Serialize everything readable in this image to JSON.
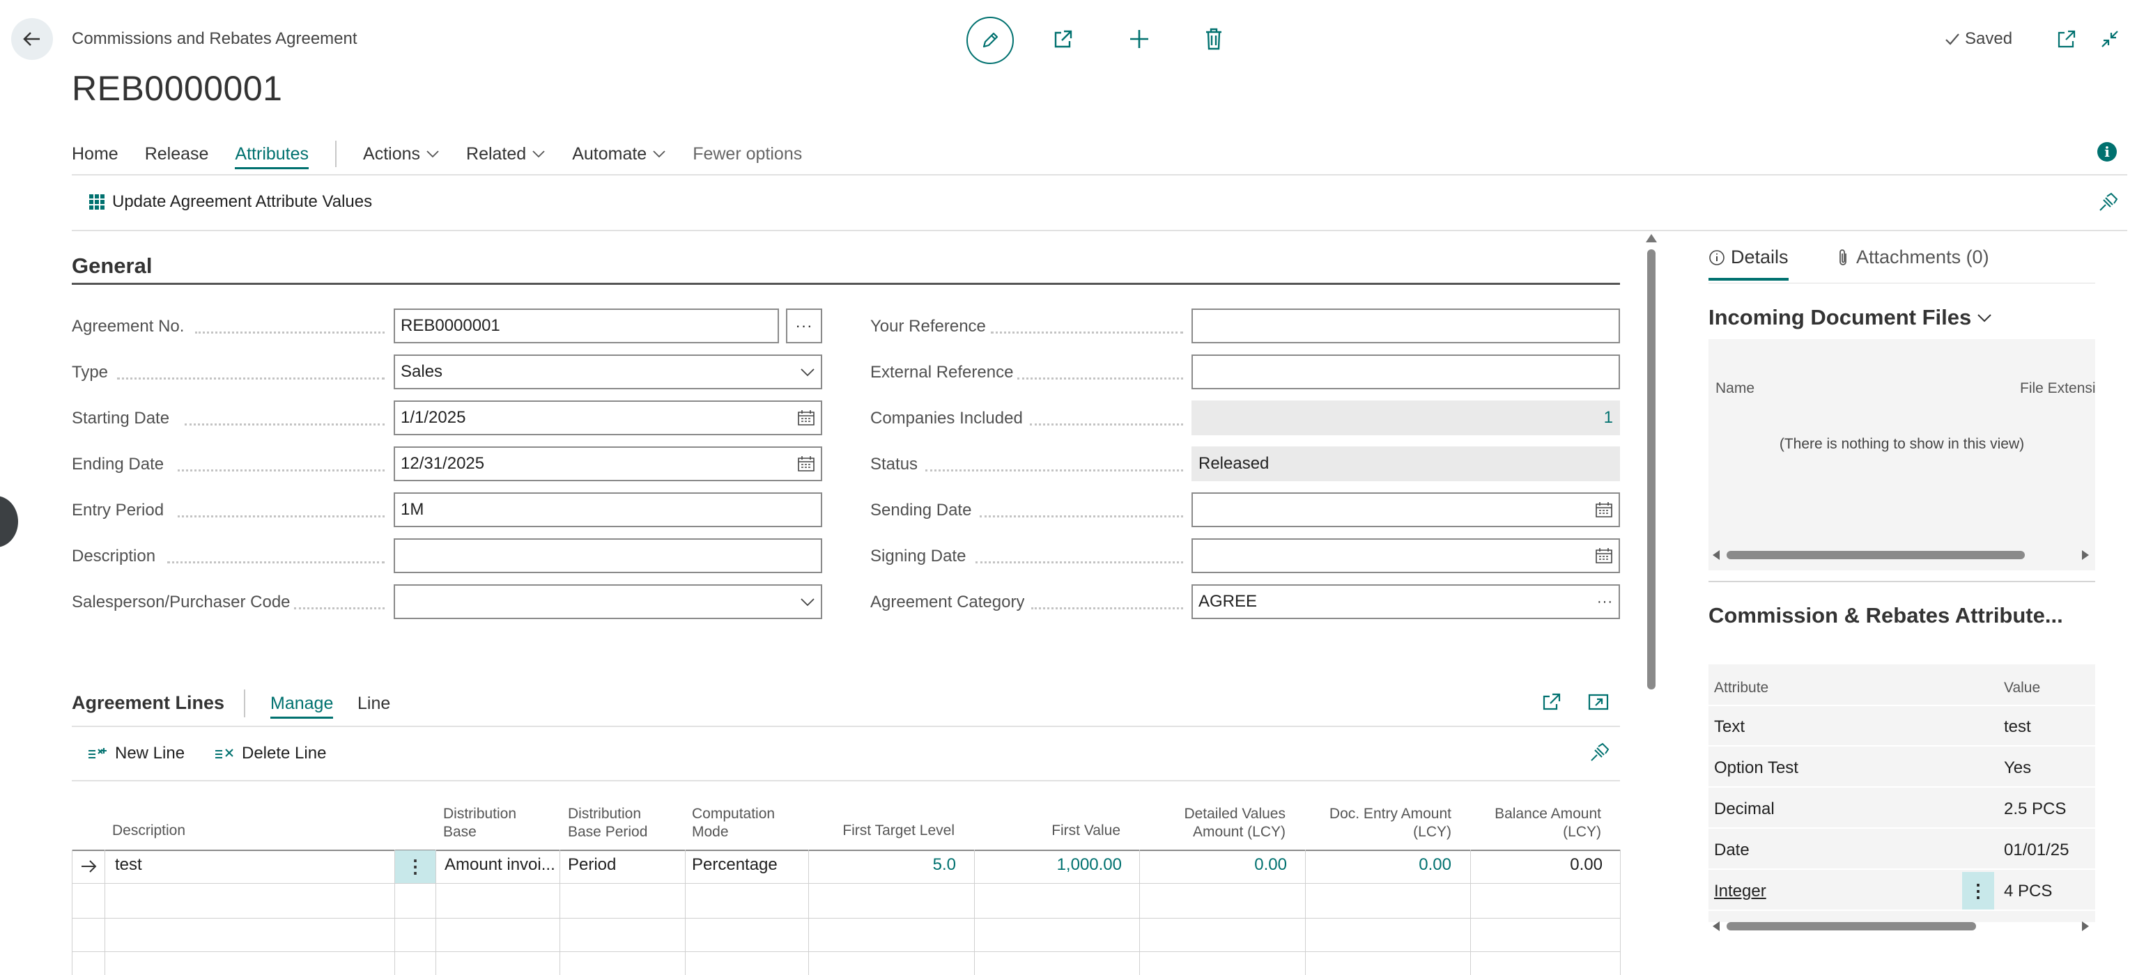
{
  "header": {
    "breadcrumb": "Commissions and Rebates Agreement",
    "title": "REB0000001",
    "saved_label": "Saved"
  },
  "icons": {
    "back": "arrow-left-icon",
    "edit": "pencil-icon",
    "share": "share-icon",
    "new": "plus-icon",
    "delete": "trash-icon",
    "open_new": "open-in-new-window-icon",
    "collapse": "collapse-icon",
    "info": "info-icon",
    "pin": "pin-icon"
  },
  "actionbar": {
    "items": [
      "Home",
      "Release",
      "Attributes",
      "Actions",
      "Related",
      "Automate",
      "Fewer options"
    ],
    "active": "Attributes",
    "sub_action": "Update Agreement Attribute Values"
  },
  "general": {
    "title": "General",
    "left": [
      {
        "label": "Agreement No.",
        "value": "REB0000001"
      },
      {
        "label": "Type",
        "value": "Sales"
      },
      {
        "label": "Starting Date",
        "value": "1/1/2025"
      },
      {
        "label": "Ending Date",
        "value": "12/31/2025"
      },
      {
        "label": "Entry Period",
        "value": "1M"
      },
      {
        "label": "Description",
        "value": ""
      },
      {
        "label": "Salesperson/Purchaser Code",
        "value": ""
      }
    ],
    "right": [
      {
        "label": "Your Reference",
        "value": ""
      },
      {
        "label": "External Reference",
        "value": ""
      },
      {
        "label": "Companies Included",
        "value": "1"
      },
      {
        "label": "Status",
        "value": "Released"
      },
      {
        "label": "Sending Date",
        "value": ""
      },
      {
        "label": "Signing Date",
        "value": ""
      },
      {
        "label": "Agreement Category",
        "value": "AGREE"
      }
    ]
  },
  "lines": {
    "title": "Agreement Lines",
    "tabs": [
      "Manage",
      "Line"
    ],
    "actions": {
      "new": "New Line",
      "delete": "Delete Line"
    },
    "columns": {
      "description": "Description",
      "dist_base": [
        "Distribution",
        "Base"
      ],
      "dist_period": [
        "Distribution",
        "Base Period"
      ],
      "computation": [
        "Computation",
        "Mode"
      ],
      "first_target": "First Target Level",
      "first_value": "First Value",
      "detailed": [
        "Detailed Values",
        "Amount (LCY)"
      ],
      "doc_entry": [
        "Doc. Entry Amount",
        "(LCY)"
      ],
      "balance": [
        "Balance Amount",
        "(LCY)"
      ]
    },
    "rows": [
      {
        "description": "test",
        "dist_base": "Amount invoi...",
        "dist_period": "Period",
        "computation": "Percentage",
        "first_target": "5.0",
        "first_value": "1,000.00",
        "detailed": "0.00",
        "doc_entry": "0.00",
        "balance": "0.00"
      }
    ]
  },
  "factbox": {
    "tabs": {
      "details": "Details",
      "attachments": "Attachments (0)"
    },
    "incoming": {
      "title": "Incoming Document Files",
      "col_name": "Name",
      "col_ext": "File Extensio",
      "empty": "(There is nothing to show in this view)"
    },
    "attributes": {
      "title": "Commission & Rebates Attribute...",
      "col_attr": "Attribute",
      "col_value": "Value",
      "rows": [
        {
          "attribute": "Text",
          "value": "test"
        },
        {
          "attribute": "Option Test",
          "value": "Yes"
        },
        {
          "attribute": "Decimal",
          "value": "2.5 PCS"
        },
        {
          "attribute": "Date",
          "value": "01/01/25"
        },
        {
          "attribute": "Integer",
          "value": "4 PCS"
        }
      ]
    }
  },
  "colors": {
    "accent": "#00716F",
    "readonly_bg": "#eaeaea"
  }
}
